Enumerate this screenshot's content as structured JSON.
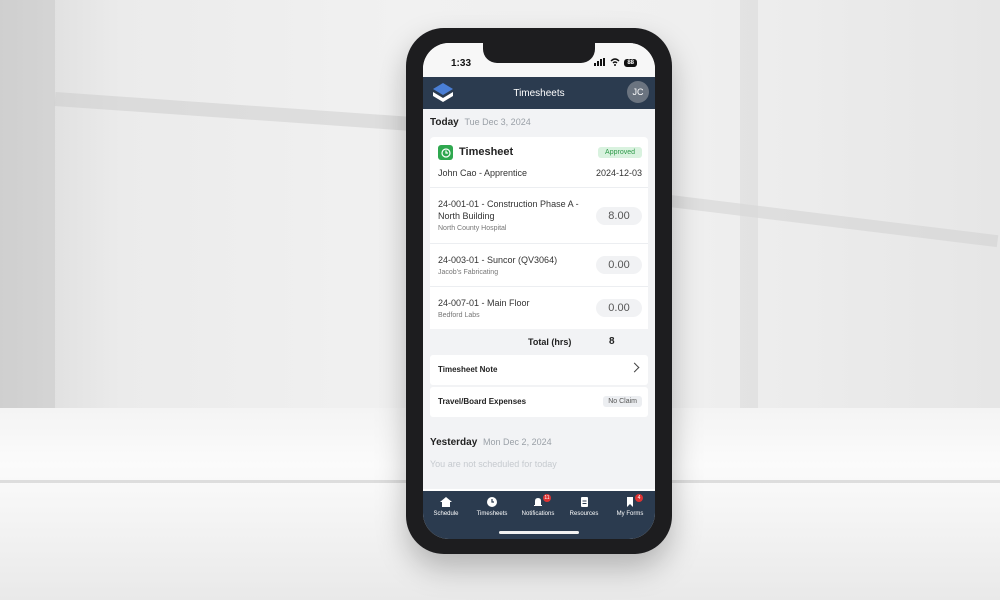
{
  "status": {
    "time": "1:33",
    "battery": "88"
  },
  "header": {
    "title": "Timesheets",
    "avatar_initials": "JC"
  },
  "today": {
    "label": "Today",
    "date": "Tue Dec 3, 2024",
    "card": {
      "title": "Timesheet",
      "status": "Approved",
      "employee": "John Cao - Apprentice",
      "date": "2024-12-03",
      "jobs": [
        {
          "title": "24-001-01 - Construction Phase A - North Building",
          "site": "North County Hospital",
          "hours": "8.00"
        },
        {
          "title": "24-003-01 - Suncor (QV3064)",
          "site": "Jacob's Fabricating",
          "hours": "0.00"
        },
        {
          "title": "24-007-01 - Main Floor",
          "site": "Bedford Labs",
          "hours": "0.00"
        }
      ],
      "total_label": "Total (hrs)",
      "total_value": "8"
    },
    "note_label": "Timesheet Note",
    "expenses_label": "Travel/Board Expenses",
    "expenses_value": "No Claim"
  },
  "yesterday": {
    "label": "Yesterday",
    "date": "Mon Dec 2, 2024",
    "message": "You are not scheduled for today"
  },
  "tabs": [
    {
      "label": "Schedule",
      "icon": "home-icon"
    },
    {
      "label": "Timesheets",
      "icon": "clock-icon"
    },
    {
      "label": "Notifications",
      "icon": "bell-icon",
      "badge": "11"
    },
    {
      "label": "Resources",
      "icon": "document-icon"
    },
    {
      "label": "My Forms",
      "icon": "bookmark-icon",
      "badge": "4"
    }
  ],
  "colors": {
    "header": "#2b3b4f",
    "approved_bg": "#d9f2df",
    "approved_text": "#2e9a49",
    "timesheet_icon": "#2fa84f"
  }
}
